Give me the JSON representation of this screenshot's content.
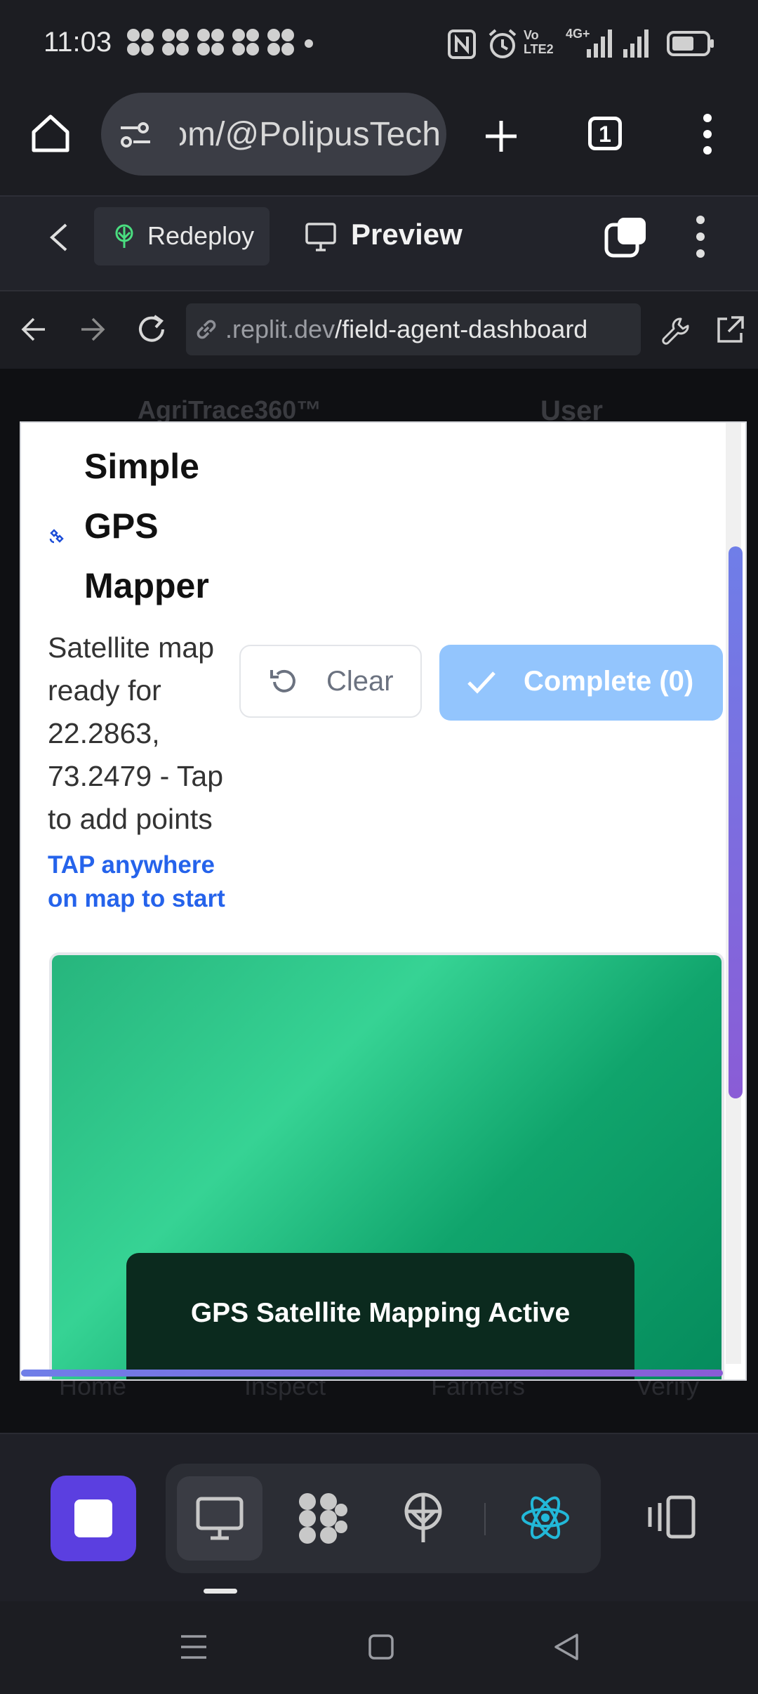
{
  "status_bar": {
    "time": "11:03",
    "icons": [
      "grid-app-icon",
      "grid-app-icon",
      "grid-app-icon",
      "grid-app-icon",
      "grid-app-icon",
      "dot-icon",
      "nfc-icon",
      "alarm-icon",
      "volte-icon",
      "signal-icon",
      "signal-icon",
      "battery-icon"
    ],
    "volte": "Vo LTE2",
    "network": "4G+"
  },
  "browser": {
    "url_text": "om/@PolipusTech",
    "tab_count": "1"
  },
  "replit_bar": {
    "redeploy_label": "Redeploy",
    "preview_label": "Preview"
  },
  "webview_nav": {
    "url_domain": ".replit.dev",
    "url_path": "/field-agent-dashboard"
  },
  "background_page": {
    "app_name": "AgriTrace360™",
    "user_label": "User",
    "bottom_tabs": [
      "Home",
      "Inspect",
      "Farmers",
      "Verify"
    ]
  },
  "modal": {
    "title_lines": [
      "Simple",
      "GPS",
      "Mapper"
    ],
    "title_icon": "satellite-icon",
    "subtitle_lines": [
      "Satellite map",
      "ready for",
      "22.2863,",
      "73.2479 - Tap",
      "to add points"
    ],
    "tap_hint_lines": [
      "TAP anywhere",
      "on map to start"
    ],
    "clear_label": "Clear",
    "complete_label": "Complete (0)",
    "map_overlay_title": "GPS Satellite Mapping Active",
    "colors": {
      "accent": "#2563eb",
      "complete_button": "#93c5fd",
      "map_green": "#10b981"
    }
  },
  "toolbar": {
    "icons": [
      "stop-icon",
      "monitor-icon",
      "shapes-icon",
      "deploy-icon",
      "react-icon",
      "layout-icon"
    ]
  },
  "android_nav": {
    "icons": [
      "menu-icon",
      "home-square-icon",
      "back-triangle-icon"
    ]
  }
}
